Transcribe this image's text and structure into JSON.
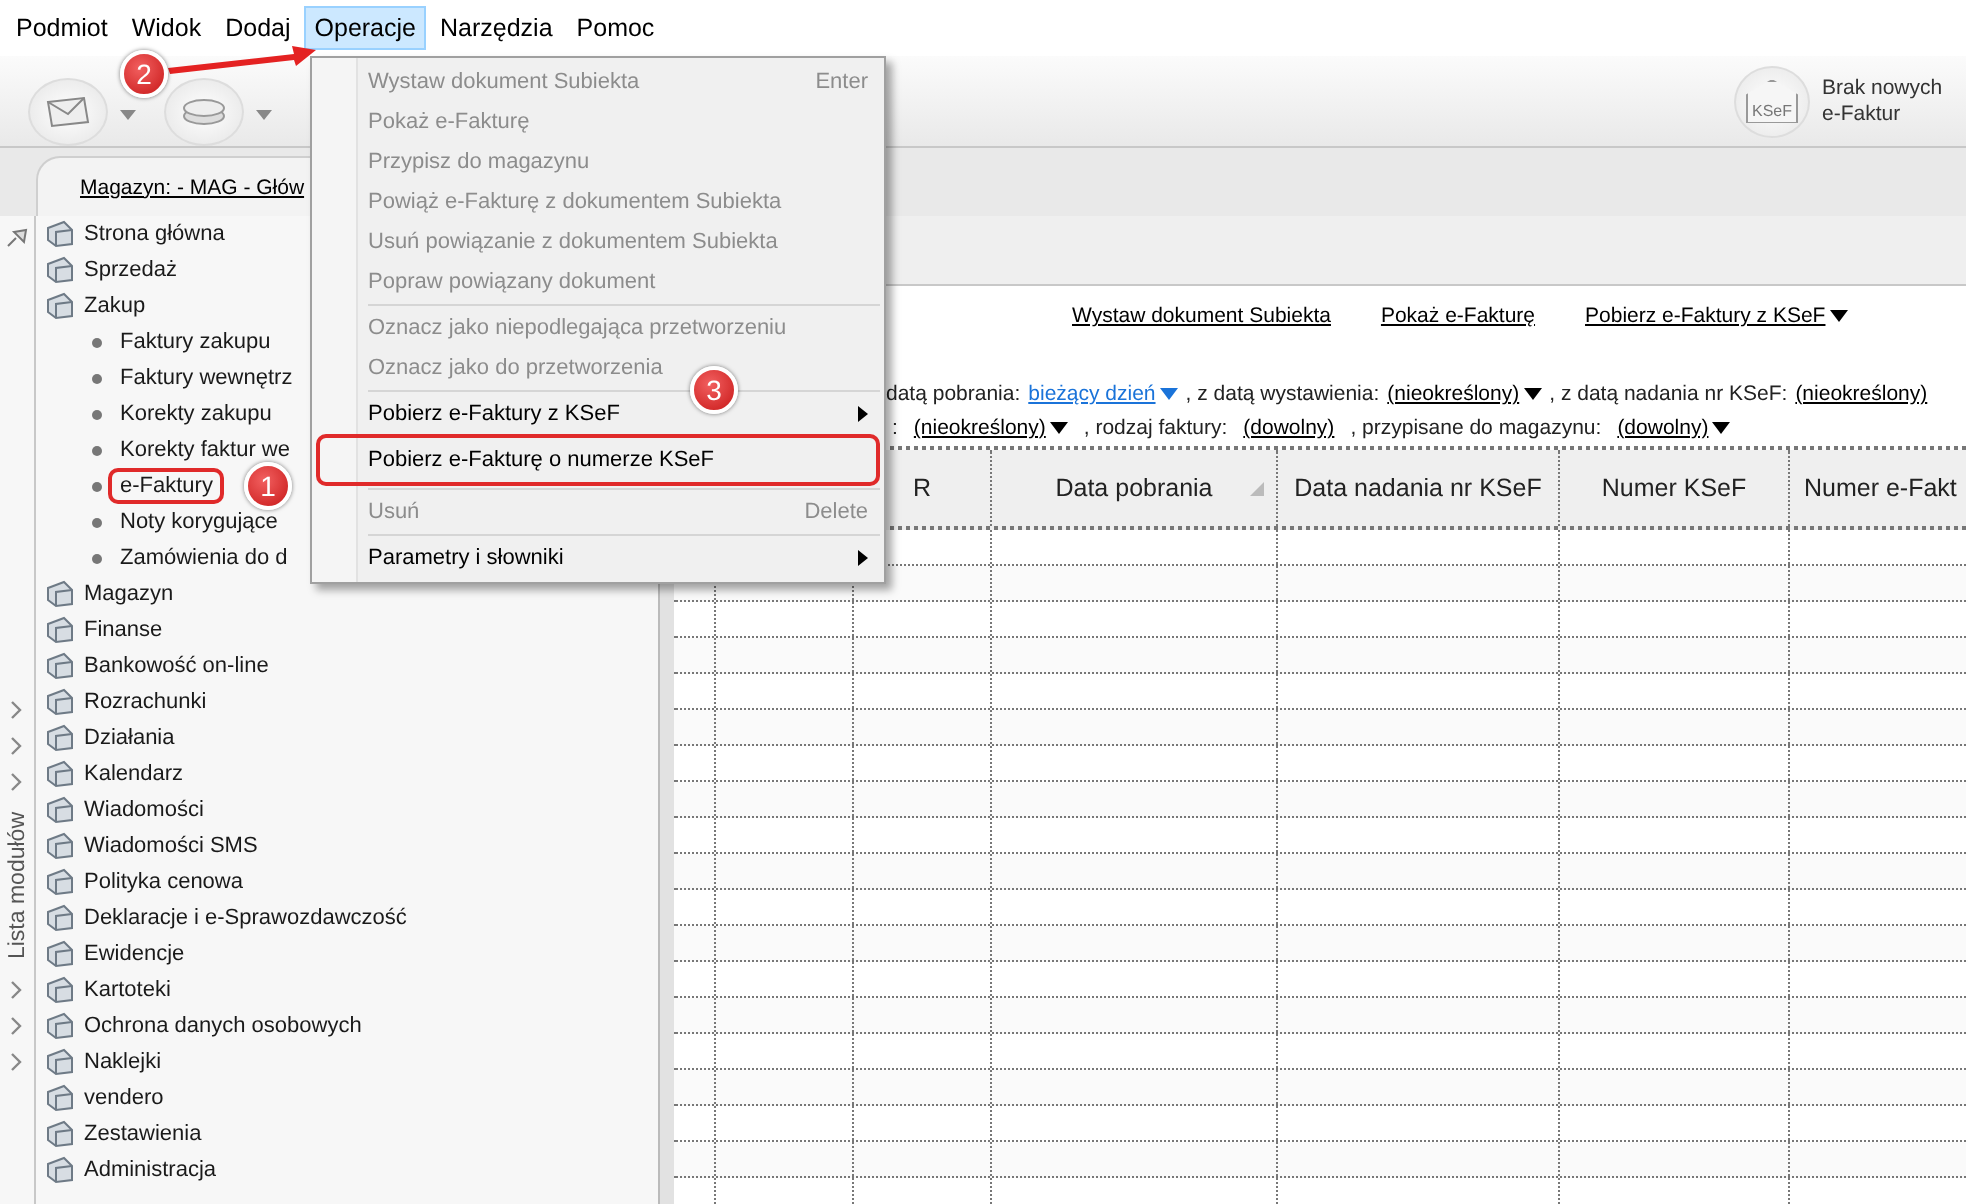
{
  "menubar": [
    {
      "label": "Podmiot",
      "selected": false
    },
    {
      "label": "Widok",
      "selected": false
    },
    {
      "label": "Dodaj",
      "selected": false
    },
    {
      "label": "Operacje",
      "selected": true
    },
    {
      "label": "Narzędzia",
      "selected": false
    },
    {
      "label": "Pomoc",
      "selected": false
    }
  ],
  "menu": [
    {
      "kind": "item",
      "label": "Wystaw dokument Subiekta",
      "shortcut": "Enter",
      "disabled": true,
      "submenu": false
    },
    {
      "kind": "item",
      "label": "Pokaż e-Fakturę",
      "disabled": true,
      "submenu": false
    },
    {
      "kind": "item",
      "label": "Przypisz do magazynu",
      "disabled": true,
      "submenu": false
    },
    {
      "kind": "item",
      "label": "Powiąż e-Fakturę z dokumentem Subiekta",
      "disabled": true,
      "submenu": false
    },
    {
      "kind": "item",
      "label": "Usuń powiązanie z dokumentem Subiekta",
      "disabled": true,
      "submenu": false
    },
    {
      "kind": "item",
      "label": "Popraw powiązany dokument",
      "disabled": true,
      "submenu": false
    },
    {
      "kind": "separator"
    },
    {
      "kind": "item",
      "label": "Oznacz jako niepodlegająca przetworzeniu",
      "disabled": true,
      "submenu": false
    },
    {
      "kind": "item",
      "label": "Oznacz jako do przetworzenia",
      "disabled": true,
      "submenu": false
    },
    {
      "kind": "separator"
    },
    {
      "kind": "item",
      "label": "Pobierz e-Faktury z KSeF",
      "disabled": false,
      "submenu": true
    },
    {
      "kind": "item",
      "label": "Pobierz e-Fakturę o numerze KSeF",
      "disabled": false,
      "submenu": false
    },
    {
      "kind": "separator"
    },
    {
      "kind": "item",
      "label": "Usuń",
      "shortcut": "Delete",
      "disabled": true,
      "submenu": false
    },
    {
      "kind": "separator"
    },
    {
      "kind": "item",
      "label": "Parametry i słowniki",
      "disabled": false,
      "submenu": true
    }
  ],
  "toolbar": {
    "status_icon_label": "KSeF",
    "status": "Brak nowych e-Faktur"
  },
  "tab": {
    "label": "Magazyn: - MAG - Głów"
  },
  "sidebar": {
    "strip_label": "Lista modułów",
    "items": [
      {
        "label": "Strona główna"
      },
      {
        "label": "Sprzedaż"
      },
      {
        "label": "Zakup",
        "children": [
          {
            "label": "Faktury zakupu"
          },
          {
            "label": "Faktury wewnętrz"
          },
          {
            "label": "Korekty zakupu"
          },
          {
            "label": "Korekty faktur we"
          },
          {
            "label": "e-Faktury"
          },
          {
            "label": "Noty korygujące"
          },
          {
            "label": "Zamówienia do d"
          }
        ]
      },
      {
        "label": "Magazyn"
      },
      {
        "label": "Finanse"
      },
      {
        "label": "Bankowość on-line"
      },
      {
        "label": "Rozrachunki"
      },
      {
        "label": "Działania"
      },
      {
        "label": "Kalendarz"
      },
      {
        "label": "Wiadomości"
      },
      {
        "label": "Wiadomości SMS"
      },
      {
        "label": "Polityka cenowa"
      },
      {
        "label": "Deklaracje i e-Sprawozdawczość"
      },
      {
        "label": "Ewidencje"
      },
      {
        "label": "Kartoteki"
      },
      {
        "label": "Ochrona danych osobowych"
      },
      {
        "label": "Naklejki"
      },
      {
        "label": "vendero"
      },
      {
        "label": "Zestawienia"
      },
      {
        "label": "Administracja"
      }
    ]
  },
  "actions": [
    {
      "label": "Wystaw dokument Subiekta",
      "dropdown": false
    },
    {
      "label": "Pokaż e-Fakturę",
      "dropdown": false
    },
    {
      "label": "Pobierz e-Faktury z KSeF",
      "dropdown": true
    }
  ],
  "filters": [
    [
      {
        "kind": "text",
        "text": "datą pobrania:"
      },
      {
        "kind": "value",
        "text": "bieżący dzień",
        "dropdown": true,
        "active": true
      },
      {
        "kind": "text",
        "text": ", z datą wystawienia:"
      },
      {
        "kind": "value",
        "text": "(nieokreślony)",
        "dropdown": true,
        "active": false
      },
      {
        "kind": "text",
        "text": ", z datą nadania nr KSeF:"
      },
      {
        "kind": "value",
        "text": "(nieokreślony)",
        "dropdown": false,
        "active": false
      }
    ],
    [
      {
        "kind": "text",
        "text": ":"
      },
      {
        "kind": "value",
        "text": "(nieokreślony)",
        "dropdown": true,
        "active": false
      },
      {
        "kind": "text",
        "text": ", rodzaj faktury:"
      },
      {
        "kind": "value",
        "text": "(dowolny)",
        "dropdown": false,
        "active": false
      },
      {
        "kind": "text",
        "text": ", przypisane do magazynu:"
      },
      {
        "kind": "value",
        "text": "(dowolny)",
        "dropdown": true,
        "active": false
      }
    ]
  ],
  "table": {
    "columns": [
      {
        "label": "R",
        "sorted": false
      },
      {
        "label": "Data pobrania",
        "sorted": true
      },
      {
        "label": "Data nadania nr KSeF",
        "sorted": false
      },
      {
        "label": "Numer KSeF",
        "sorted": false
      },
      {
        "label": "Numer e-Fakt",
        "sorted": false
      }
    ]
  },
  "annotations": [
    {
      "number": "1",
      "kind": "frame"
    },
    {
      "number": "2",
      "kind": "arrow"
    },
    {
      "number": "3",
      "kind": "frame"
    }
  ]
}
